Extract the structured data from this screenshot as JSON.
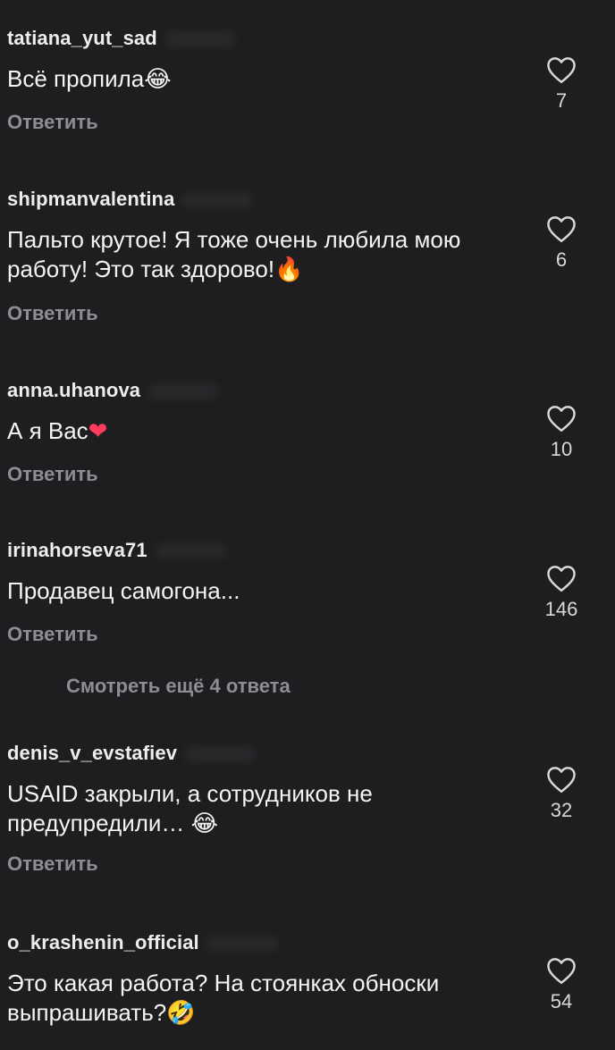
{
  "reply_label": "Ответить",
  "comments": [
    {
      "username": "tatiana_yut_sad",
      "text": "Всё пропила",
      "emoji": "😂",
      "likes": "7"
    },
    {
      "username": "shipmanvalentina",
      "text": "Пальто крутое! Я тоже очень любила мою работу! Это так здорово!",
      "emoji": "🔥",
      "likes": "6"
    },
    {
      "username": "anna.uhanova",
      "text": "А я Вас",
      "emoji": "❤",
      "likes": "10"
    },
    {
      "username": "irinahorseva71",
      "text": "Продавец самогона...",
      "emoji": "",
      "likes": "146"
    },
    {
      "username": "denis_v_evstafiev",
      "text": "USAID закрыли, а сотрудников не предупредили… ",
      "emoji": "😂",
      "likes": "32"
    },
    {
      "username": "o_krashenin_official",
      "text": "Это какая работа? На стоянках обноски выпрашивать?",
      "emoji": "🤣",
      "likes": "54"
    }
  ],
  "view_more_replies": "Смотреть ещё 4 ответа",
  "colors": {
    "background": "#1e1e20",
    "secondary_text": "#8e8e92",
    "primary_text": "#f4f4f4"
  },
  "icons": {
    "like": "heart-outline-icon"
  }
}
